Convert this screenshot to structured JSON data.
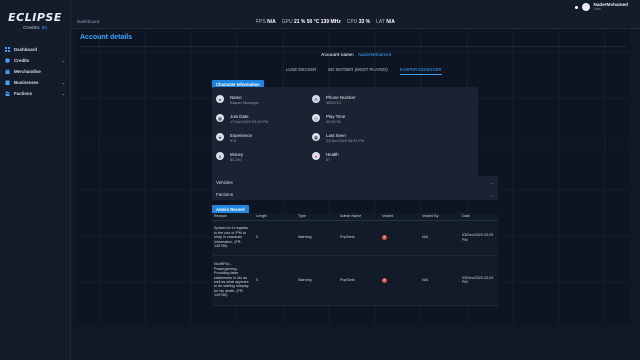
{
  "brand": {
    "logo": "ECLIPSE",
    "credits_label": "Credits:",
    "credits_value": "50"
  },
  "sidebar": {
    "items": [
      {
        "label": "Dashboard",
        "icon": "grid-icon",
        "chevron": false
      },
      {
        "label": "Credits",
        "icon": "coins-icon",
        "chevron": true
      },
      {
        "label": "Merchandise",
        "icon": "bag-icon",
        "chevron": false
      },
      {
        "label": "Businesses",
        "icon": "building-icon",
        "chevron": true
      },
      {
        "label": "Factions",
        "icon": "users-icon",
        "chevron": true
      }
    ]
  },
  "topbar": {
    "breadcrumb": "Dashboard",
    "stats": [
      {
        "label": "FPS",
        "value": "N/A"
      },
      {
        "label": "GPU",
        "value": "21 % 50 °C 139 MHz"
      },
      {
        "label": "CPU",
        "value": "33 %"
      },
      {
        "label": "LAT",
        "value": "N/A"
      }
    ],
    "user_name": "NaderMohamed",
    "user_role": "User"
  },
  "page": {
    "title": "Account details",
    "account_label": "Account name:",
    "account_value": "NaderMohamed",
    "tabs": [
      "LUKE DECKER",
      "ED SNYDER (MOST PLAYED)",
      "KASPER MOSINGER"
    ],
    "active_tab": 2,
    "char_badge": "Character Information",
    "fields": [
      {
        "label": "Name",
        "value": "Kasper Mosinger",
        "icon": "user-icon"
      },
      {
        "label": "Phone Number",
        "value": "4893710",
        "icon": "phone-icon"
      },
      {
        "label": "Join Date",
        "value": "17/Jun/2024 03:43 PM",
        "icon": "calendar-icon"
      },
      {
        "label": "Play Time",
        "value": "00:02:36",
        "icon": "clock-icon"
      },
      {
        "label": "Experience",
        "value": "976",
        "icon": "star-icon"
      },
      {
        "label": "Last Seen",
        "value": "24/Jun/2024 06:31 PM",
        "icon": "calendar-check-icon"
      },
      {
        "label": "Money",
        "value": "$3,250",
        "icon": "dollar-icon"
      },
      {
        "label": "Health",
        "value": "87",
        "icon": "heart-icon"
      }
    ],
    "accordions": [
      "Vehicles",
      "Factions"
    ],
    "admin_badge": "Admin Record",
    "table": {
      "headers": [
        "Reason",
        "Length",
        "Type",
        "Admin Name",
        "Voided",
        "Voided By",
        "Date"
      ],
      "rows": [
        {
          "reason": "Spoken to in regards to the use of /PM to relay in character information. (FR-149756)",
          "length": "0",
          "type": "Warning",
          "admin": "PopTarts",
          "voided": "x",
          "voided_by": "N/A",
          "date": "03/Dec/2023 03:25 PM"
        },
        {
          "reason": "NonRP#1 - Powergaming - Providing false statements in /do as well as what appears to be stalling roleplay for his death. (FR-149756)",
          "length": "0",
          "type": "Warning",
          "admin": "PopTarts",
          "voided": "x",
          "voided_by": "N/A",
          "date": "03/Dec/2023 03:24 PM"
        }
      ]
    }
  }
}
